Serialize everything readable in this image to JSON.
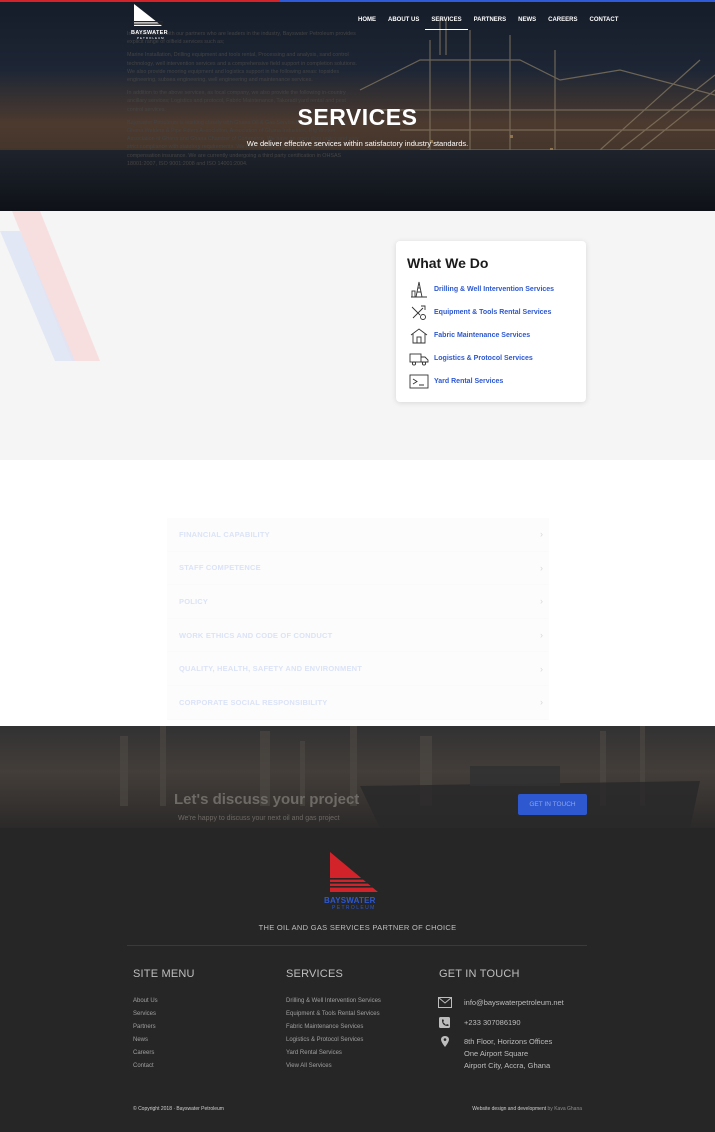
{
  "brand": {
    "name": "BAYSWATER",
    "sub": "PETROLEUM",
    "red": "#d2232a",
    "blue": "#2d58d0"
  },
  "nav": {
    "items": [
      "HOME",
      "ABOUT US",
      "SERVICES",
      "PARTNERS",
      "NEWS",
      "CAREERS",
      "CONTACT"
    ],
    "active": "SERVICES"
  },
  "hero": {
    "title": "SERVICES",
    "subtitle": "We deliver effective services within satisfactory industry standards."
  },
  "intro": {
    "paragraphs": [
      "In collaboration with our partners who are leaders in the industry, Bayswater Petroleum provides explicit range of oilfield services such as;",
      "Marine Installation, Drilling equipment and tools rental, Processing and analysis, sand control technology, well intervention services and a comprehensive field support in completion solutions. We also provide mooring equipment and logistics support in the following areas: topsides engineering, subsea engineering, well engineering and maintenance services.",
      "In addition to the above services, as local company, we also provide the following in-country ancillary services; Logistics and protocol, Fabric Maintenance, Takoradi yard rental and pest control services.",
      "Bayswater Petroleum is working closely with Ghana Oil & Gas Service Providers Association, Ghana Welders & Pipe Fitters Association, Association of Ghana Industries, Rig Worker Association of Ghana and Ghana Chamber of Commerce. We have an open door policy and very strict compliance with statutory requirements. We have a public liability and workmen's compensation insurance. We are currently undergoing a third party certification in OHSAS 18001:2007, ISO 9001:2008 and ISO 14001:2004."
    ]
  },
  "what_we_do": {
    "title": "What We Do",
    "items": [
      {
        "label": "Drilling & Well Intervention Services",
        "icon": "drilling-rig-icon"
      },
      {
        "label": "Equipment & Tools Rental Services",
        "icon": "tools-icon"
      },
      {
        "label": "Fabric Maintenance Services",
        "icon": "house-icon"
      },
      {
        "label": "Logistics & Protocol Services",
        "icon": "truck-icon"
      },
      {
        "label": "Yard Rental Services",
        "icon": "yard-icon"
      }
    ]
  },
  "accordion": {
    "items": [
      "FINANCIAL CAPABILITY",
      "STAFF COMPETENCE",
      "POLICY",
      "WORK ETHICS AND CODE OF CONDUCT",
      "QUALITY, HEALTH, SAFETY AND ENVIRONMENT",
      "CORPORATE SOCIAL RESPONSIBILITY"
    ],
    "chevron": "›"
  },
  "cta": {
    "title": "Let's discuss your project",
    "subtitle": "We're happy to discuss your next oil and gas project",
    "button": "GET IN TOUCH"
  },
  "footer": {
    "tagline": "THE OIL AND GAS SERVICES PARTNER OF CHOICE",
    "site_menu": {
      "heading": "SITE MENU",
      "links": [
        "About Us",
        "Services",
        "Partners",
        "News",
        "Careers",
        "Contact"
      ]
    },
    "services": {
      "heading": "SERVICES",
      "links": [
        "Drilling & Well Intervention Services",
        "Equipment & Tools Rental Services",
        "Fabric Maintenance Services",
        "Logistics & Protocol Services",
        "Yard Rental Services",
        "View All Services"
      ]
    },
    "contact": {
      "heading": "GET IN TOUCH",
      "email": "info@bayswaterpetroleum.net",
      "phone": "+233 307086190",
      "address": [
        "8th Floor, Horizons Offices",
        "One Airport Square",
        "Airport City, Accra, Ghana"
      ]
    },
    "copyright": "© Copyright 2018 · Bayswater Petroleum",
    "credit_prefix": "Website design and development",
    "credit_by": "by Kava Ghana"
  }
}
